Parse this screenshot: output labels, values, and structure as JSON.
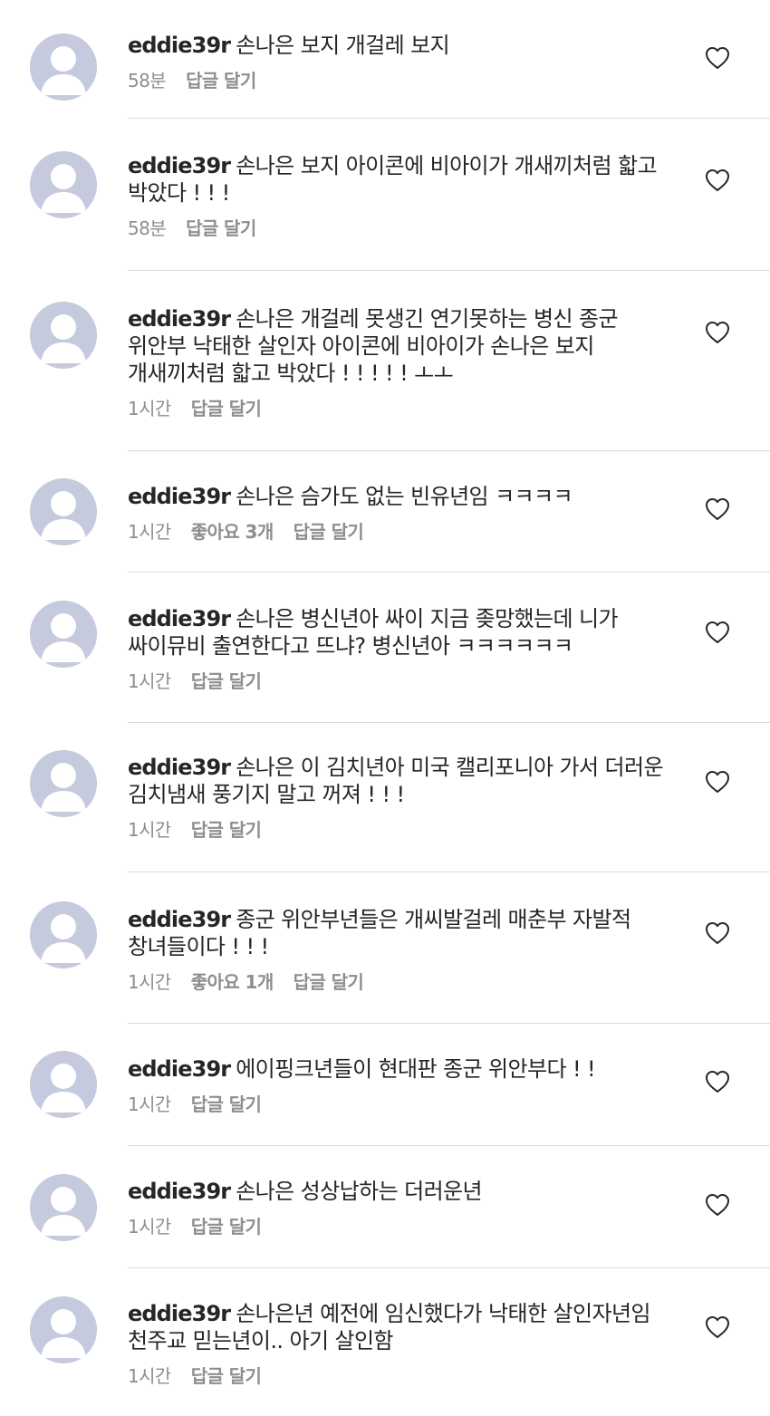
{
  "comments": [
    {
      "username": "eddie39r",
      "text": "손나은 보지 개걸레 보지",
      "time": "58분",
      "likes": "",
      "reply_label": "답글 달기"
    },
    {
      "username": "eddie39r",
      "text": "손나은 보지 아이콘에 비아이가 개새끼처럼 핣고 박았다 ! ! !",
      "time": "58분",
      "likes": "",
      "reply_label": "답글 달기"
    },
    {
      "username": "eddie39r",
      "text": "손나은 개걸레 못생긴 연기못하는 병신 종군 위안부 낙태한 살인자 아이콘에 비아이가 손나은 보지 개새끼처럼 핣고 박았다 ! ! ! ! ! ㅗㅗ",
      "time": "1시간",
      "likes": "",
      "reply_label": "답글 달기"
    },
    {
      "username": "eddie39r",
      "text": "손나은 슴가도 없는 빈유년임 ㅋㅋㅋㅋ",
      "time": "1시간",
      "likes": "좋아요 3개",
      "reply_label": "답글 달기"
    },
    {
      "username": "eddie39r",
      "text": "손나은 병신년아 싸이 지금 좆망했는데 니가 싸이뮤비 출연한다고 뜨냐? 병신년아 ㅋㅋㅋㅋㅋㅋ",
      "time": "1시간",
      "likes": "",
      "reply_label": "답글 달기"
    },
    {
      "username": "eddie39r",
      "text": "손나은 이 김치년아 미국 캘리포니아 가서 더러운 김치냄새 풍기지 말고 꺼져 ! ! !",
      "time": "1시간",
      "likes": "",
      "reply_label": "답글 달기"
    },
    {
      "username": "eddie39r",
      "text": "종군 위안부년들은 개씨발걸레 매춘부 자발적 창녀들이다 ! ! !",
      "time": "1시간",
      "likes": "좋아요 1개",
      "reply_label": "답글 달기"
    },
    {
      "username": "eddie39r",
      "text": "에이핑크년들이 현대판 종군 위안부다 ! !",
      "time": "1시간",
      "likes": "",
      "reply_label": "답글 달기"
    },
    {
      "username": "eddie39r",
      "text": "손나은 성상납하는 더러운년",
      "time": "1시간",
      "likes": "",
      "reply_label": "답글 달기"
    },
    {
      "username": "eddie39r",
      "text": "손나은년 예전에 임신했다가 낙태한 살인자년임 천주교 믿는년이.. 아기 살인함",
      "time": "1시간",
      "likes": "",
      "reply_label": "답글 달기"
    }
  ],
  "icons": {
    "avatar": "default-avatar-icon",
    "like": "heart-outline-icon"
  },
  "colors": {
    "avatar_bg": "#c5cade",
    "meta_text": "#8e8e8e",
    "divider": "#dbdbdb"
  }
}
